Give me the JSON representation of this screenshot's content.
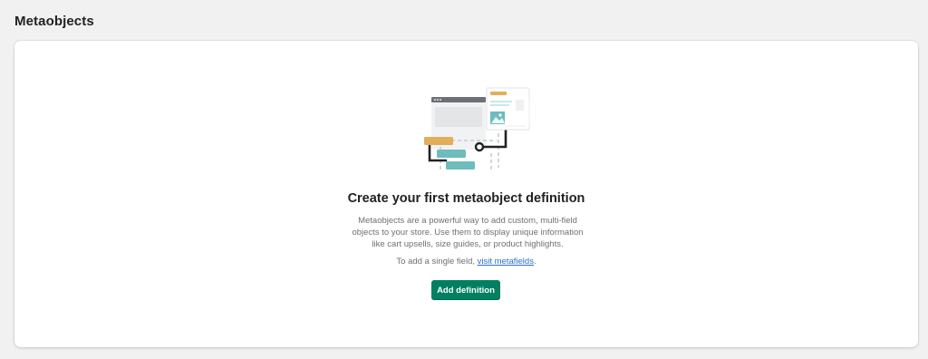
{
  "page": {
    "title": "Metaobjects"
  },
  "empty_state": {
    "heading": "Create your first metaobject definition",
    "description": "Metaobjects are a powerful way to add custom, multi-field objects to your store. Use them to display unique information like cart upsells, size guides, or product highlights.",
    "single_field_prefix": "To add a single field, ",
    "single_field_link": "visit metafields",
    "single_field_suffix": ".",
    "illustration_icon": "metaobject-illustration-icon"
  },
  "actions": {
    "add_definition_label": "Add definition"
  },
  "colors": {
    "background": "#f1f1f1",
    "card": "#ffffff",
    "primary_button": "#008060",
    "link": "#2c6ecb",
    "accent_orange": "#e3ae5a",
    "accent_teal": "#6ebcbd"
  }
}
